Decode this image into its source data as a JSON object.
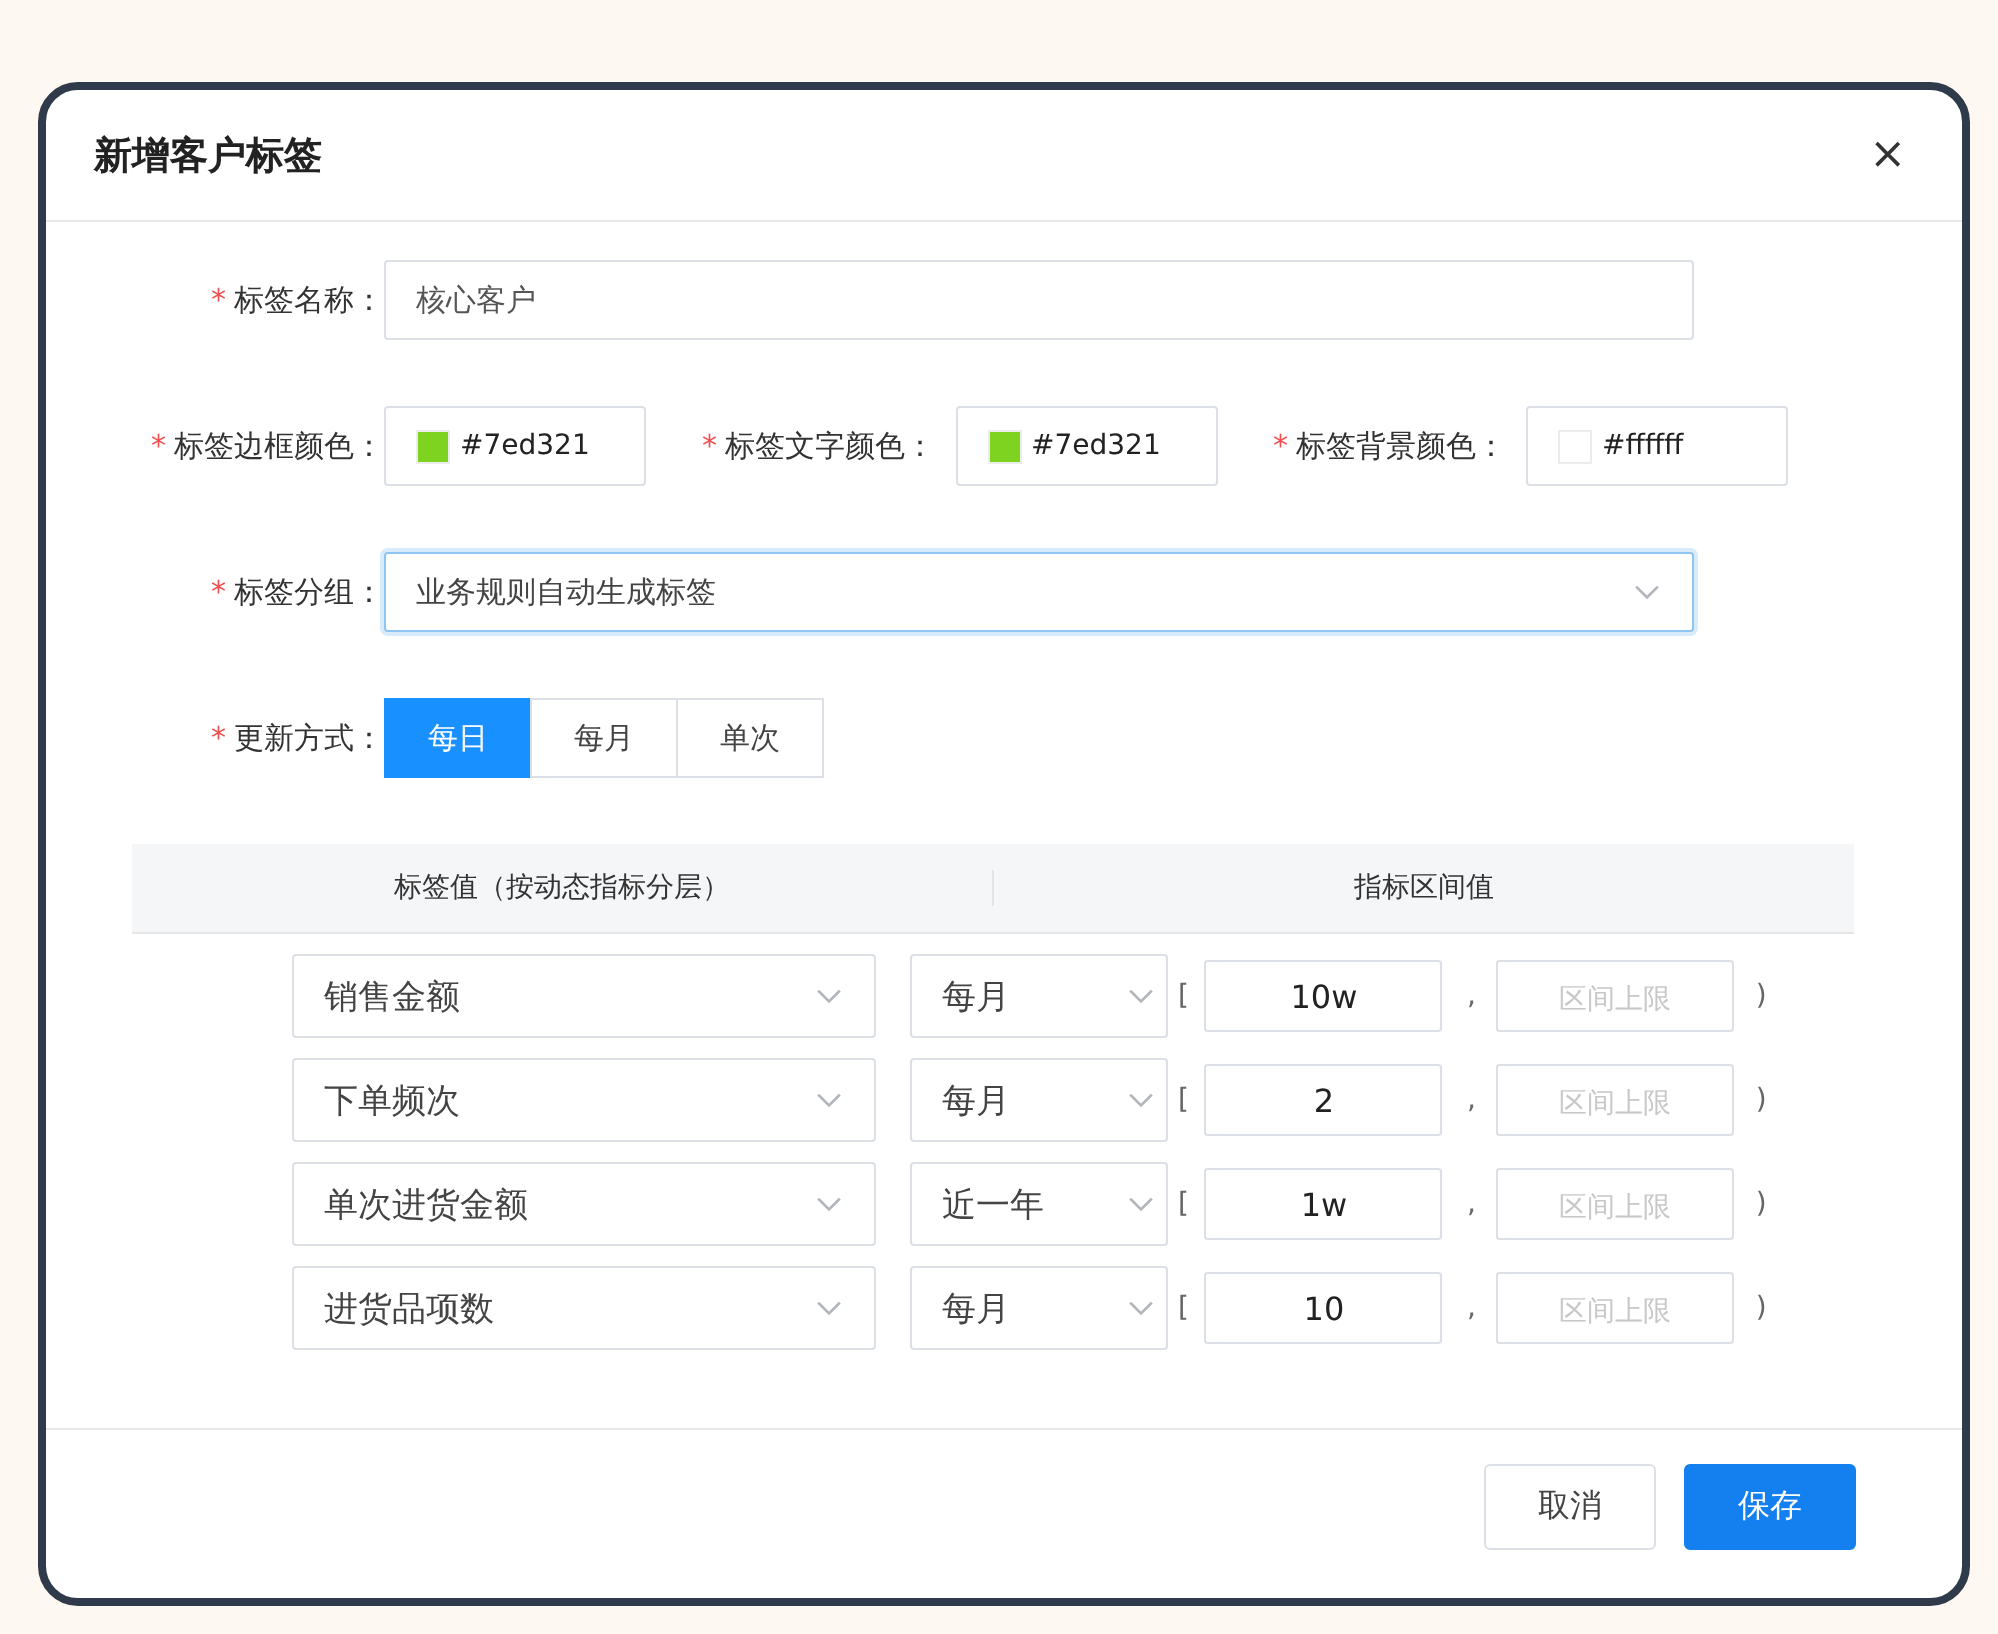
{
  "dialog": {
    "title": "新增客户标签",
    "close": "×"
  },
  "form": {
    "name_field": {
      "mark": "*",
      "label": "标签名称：",
      "value": "核心客户"
    },
    "colors": [
      {
        "mark": "*",
        "label": "标签边框颜色：",
        "value": "#7ed321",
        "color": "#7ed321"
      },
      {
        "mark": "*",
        "label": "标签文字颜色：",
        "value": "#7ed321",
        "color": "#7ed321"
      },
      {
        "mark": "*",
        "label": "标签背景颜色：",
        "value": "#ffffff",
        "color": "#ffffff"
      }
    ],
    "group": {
      "mark": "*",
      "label": "标签分组：",
      "value": "业务规则自动生成标签",
      "focused": true
    },
    "update": {
      "mark": "*",
      "label": "更新方式：",
      "options": [
        {
          "label": "每日",
          "selected": true
        },
        {
          "label": "每月",
          "selected": false
        },
        {
          "label": "单次",
          "selected": false
        }
      ]
    }
  },
  "table": {
    "columns": [
      "标签值（按动态指标分层）",
      "指标区间值"
    ],
    "rows": [
      {
        "metric": "销售金额",
        "period": "每月",
        "open": "[",
        "lower": "10w",
        "sep": ",",
        "upper_placeholder": "区间上限",
        "close": ")"
      },
      {
        "metric": "下单频次",
        "period": "每月",
        "open": "[",
        "lower": "2",
        "sep": ",",
        "upper_placeholder": "区间上限",
        "close": ")"
      },
      {
        "metric": "单次进货金额",
        "period": "近一年",
        "open": "[",
        "lower": "1w",
        "sep": ",",
        "upper_placeholder": "区间上限",
        "close": ")"
      },
      {
        "metric": "进货品项数",
        "period": "每月",
        "open": "[",
        "lower": "10",
        "sep": ",",
        "upper_placeholder": "区间上限",
        "close": ")"
      }
    ]
  },
  "footer": {
    "buttons": [
      {
        "label": "取消",
        "kind": "default"
      },
      {
        "label": "保存",
        "kind": "primary"
      }
    ]
  }
}
